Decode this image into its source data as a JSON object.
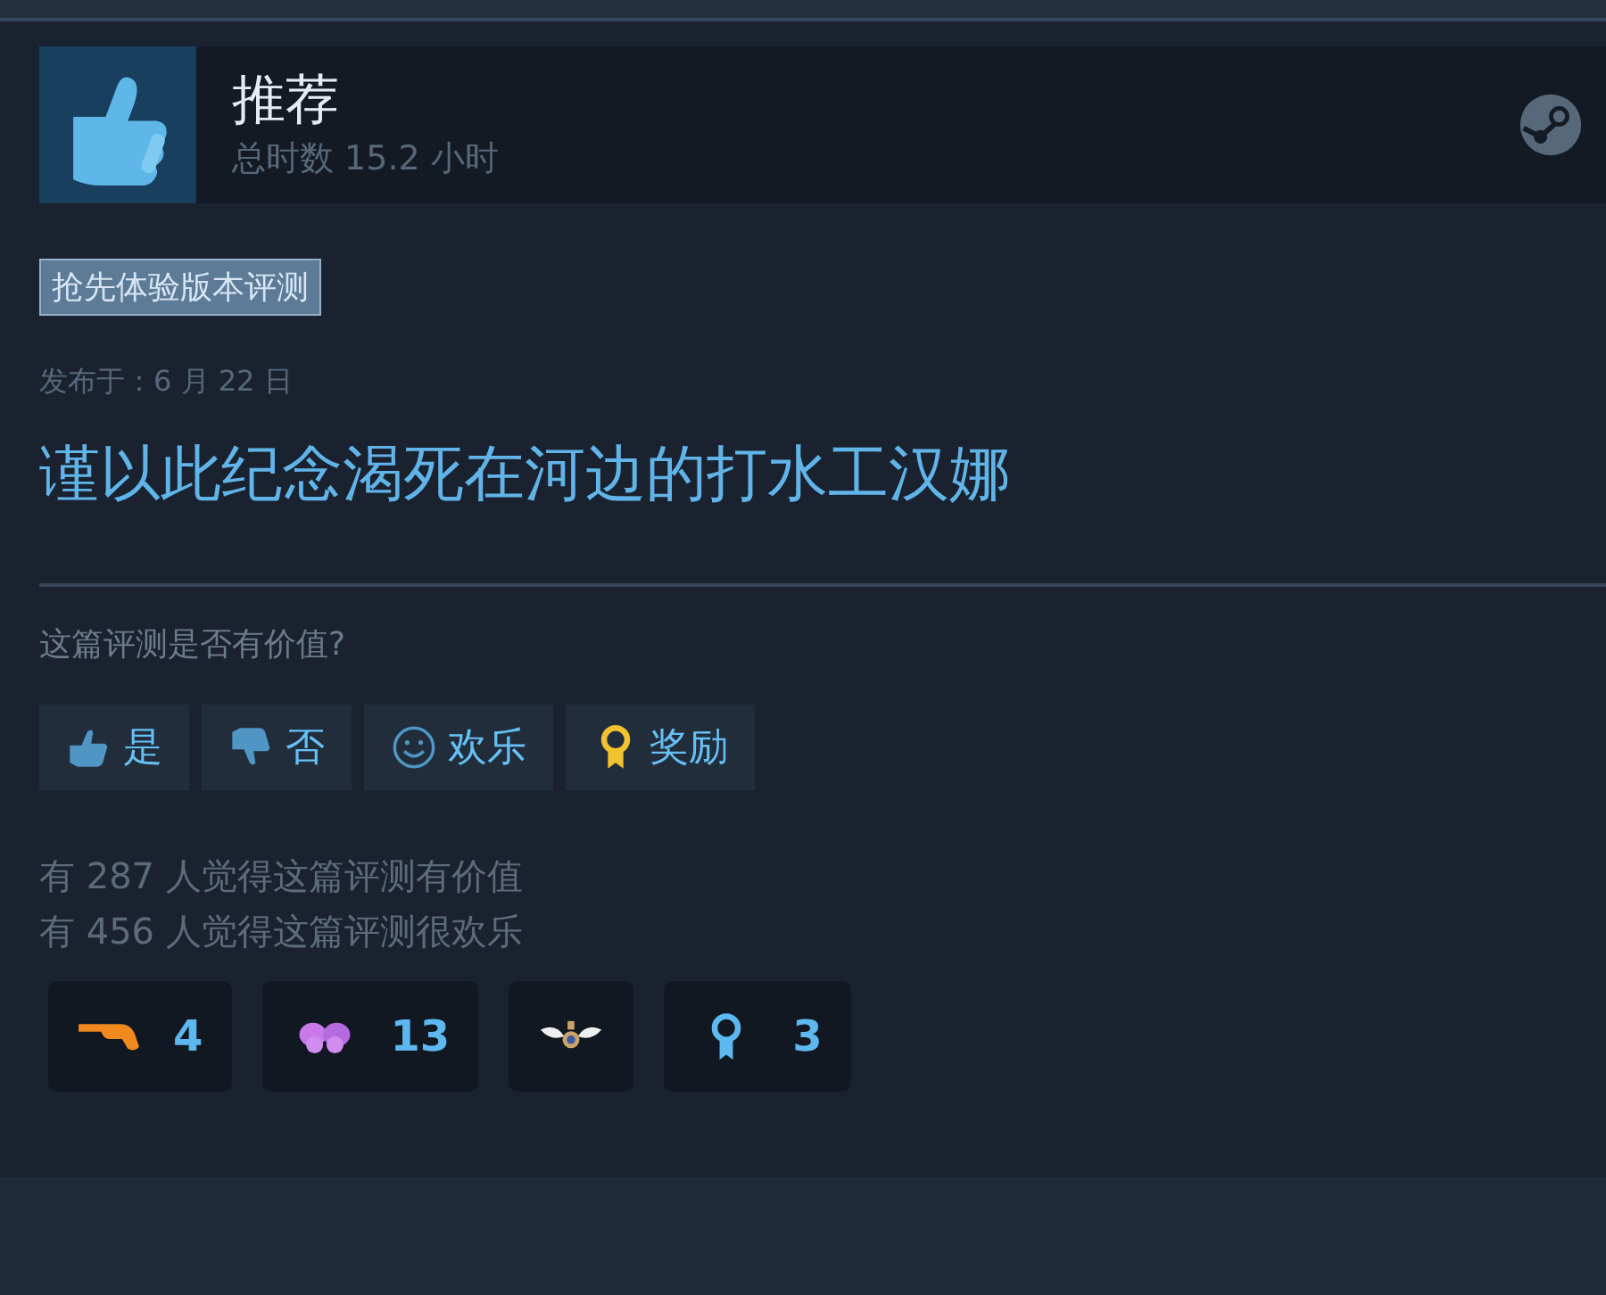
{
  "review": {
    "verdict": "推荐",
    "hours": "总时数 15.2 小时",
    "recommended": true
  },
  "tag": "抢先体验版本评测",
  "posted": "发布于：6 月 22 日",
  "body": "谨以此纪念渴死在河边的打水工汉娜",
  "question": "这篇评测是否有价值?",
  "buttons": [
    {
      "kind": "yes",
      "label": "是"
    },
    {
      "kind": "no",
      "label": "否"
    },
    {
      "kind": "funny",
      "label": "欢乐"
    },
    {
      "kind": "award",
      "label": "奖励"
    }
  ],
  "stats": [
    "有 287 人觉得这篇评测有价值",
    "有 456 人觉得这篇评测很欢乐"
  ],
  "awards": [
    {
      "kind": "pointing-hand",
      "count": "4"
    },
    {
      "kind": "butterfly",
      "count": "13"
    },
    {
      "kind": "winged-medal"
    },
    {
      "kind": "ribbon",
      "count": "3"
    }
  ]
}
